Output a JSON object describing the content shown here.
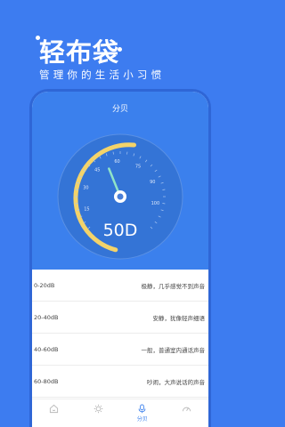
{
  "promo": {
    "headline": "轻布袋",
    "slogan": "管理你的生活小习惯"
  },
  "screen": {
    "title": "分贝"
  },
  "gauge": {
    "reading": "50D",
    "scale_labels": [
      "15",
      "30",
      "45",
      "60",
      "75",
      "90",
      "100"
    ],
    "needle_value": 50,
    "fill_fraction": 0.5,
    "colors": {
      "arc": "#f3d36a",
      "dial": "#3474d6",
      "needle": "#8fe3c7",
      "panel": "#3b80ed"
    }
  },
  "levels": [
    {
      "range": "0-20dB",
      "desc": "极静，几乎感觉不到声音"
    },
    {
      "range": "20-40dB",
      "desc": "安静，犹像轻声细语"
    },
    {
      "range": "40-60dB",
      "desc": "一般，普通室内通话声音"
    },
    {
      "range": "60-80dB",
      "desc": "吵闹，大声说话的声音"
    }
  ],
  "tabbar": {
    "tabs": [
      {
        "icon": "home-icon",
        "label": ""
      },
      {
        "icon": "sun-icon",
        "label": ""
      },
      {
        "icon": "decibel-icon",
        "label": "分贝"
      },
      {
        "icon": "gauge-icon",
        "label": ""
      }
    ],
    "active_color": "#3b80ed"
  }
}
